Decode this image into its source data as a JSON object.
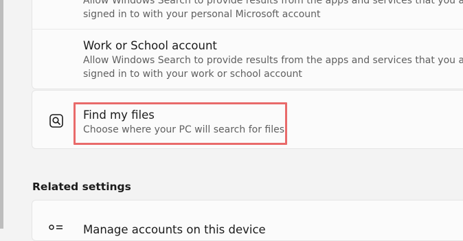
{
  "search_permissions": {
    "microsoft_account": {
      "desc_line1": "Allow Windows Search to provide results from the apps and services that you are",
      "desc_line2": "signed in to with your personal Microsoft account"
    },
    "work_account": {
      "title": "Work or School account",
      "desc_line1": "Allow Windows Search to provide results from the apps and services that you are",
      "desc_line2": "signed in to with your work or school account"
    }
  },
  "find_my_files": {
    "icon": "search-folder-icon",
    "title": "Find my files",
    "desc": "Choose where your PC will search for files",
    "highlight_color": "#e96a6a"
  },
  "related_settings": {
    "heading": "Related settings",
    "item_label": "Manage accounts on this device",
    "item_icon": "accounts-icon"
  }
}
